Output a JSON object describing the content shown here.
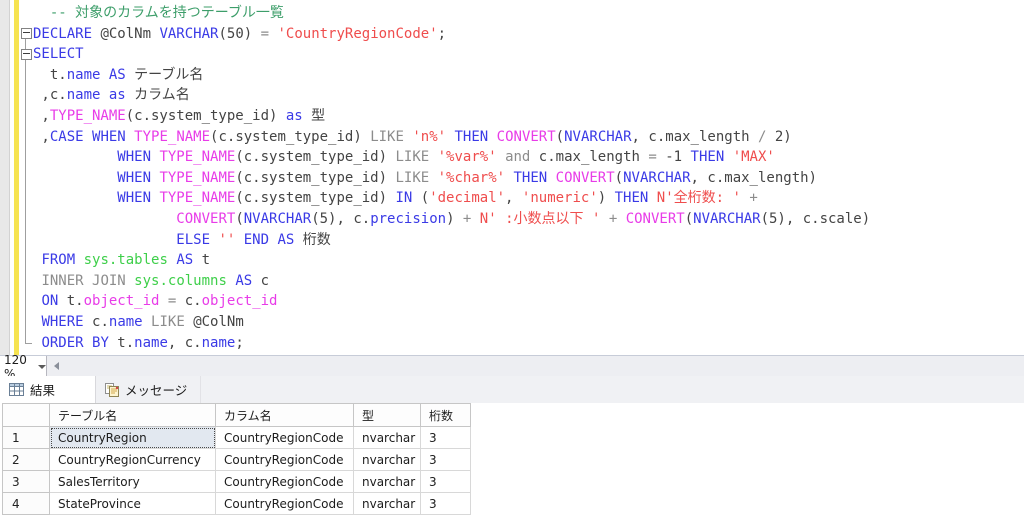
{
  "colors": {
    "keyword": "#3a3ae6",
    "operator": "#8c8c8c",
    "string": "#ef4d4d",
    "comment": "#3d9e6a",
    "system_function": "#e83ce8",
    "system_table": "#3ecf4a",
    "plain": "#444444",
    "modified_line_marker": "#f6e351"
  },
  "editor": {
    "zoom_level": "120 %",
    "code_lines": [
      {
        "tokens": [
          {
            "t": "  -- 対象のカラムを持つテーブル一覧",
            "c": "com"
          }
        ]
      },
      {
        "tokens": [
          {
            "t": "DECLARE",
            "c": "kw"
          },
          {
            "t": " @ColNm ",
            "c": "pl"
          },
          {
            "t": "VARCHAR",
            "c": "kw"
          },
          {
            "t": "(50) ",
            "c": "pl"
          },
          {
            "t": "= ",
            "c": "op"
          },
          {
            "t": "'CountryRegionCode'",
            "c": "str"
          },
          {
            "t": ";",
            "c": "pl"
          }
        ]
      },
      {
        "tokens": [
          {
            "t": "SELECT",
            "c": "kw"
          }
        ]
      },
      {
        "tokens": [
          {
            "t": "  t.",
            "c": "pl"
          },
          {
            "t": "name",
            "c": "kw"
          },
          {
            "t": " ",
            "c": "pl"
          },
          {
            "t": "AS",
            "c": "kw"
          },
          {
            "t": " テーブル名",
            "c": "pl"
          }
        ]
      },
      {
        "tokens": [
          {
            "t": " ,c.",
            "c": "pl"
          },
          {
            "t": "name",
            "c": "kw"
          },
          {
            "t": " ",
            "c": "pl"
          },
          {
            "t": "as",
            "c": "kw"
          },
          {
            "t": " カラム名",
            "c": "pl"
          }
        ]
      },
      {
        "tokens": [
          {
            "t": " ,",
            "c": "pl"
          },
          {
            "t": "TYPE_NAME",
            "c": "sys"
          },
          {
            "t": "(c.system_type_id) ",
            "c": "pl"
          },
          {
            "t": "as",
            "c": "kw"
          },
          {
            "t": " 型",
            "c": "pl"
          }
        ]
      },
      {
        "tokens": [
          {
            "t": " ,",
            "c": "pl"
          },
          {
            "t": "CASE",
            "c": "kw"
          },
          {
            "t": " ",
            "c": "pl"
          },
          {
            "t": "WHEN",
            "c": "kw"
          },
          {
            "t": " ",
            "c": "pl"
          },
          {
            "t": "TYPE_NAME",
            "c": "sys"
          },
          {
            "t": "(c.system_type_id) ",
            "c": "pl"
          },
          {
            "t": "LIKE",
            "c": "op"
          },
          {
            "t": " ",
            "c": "pl"
          },
          {
            "t": "'n%'",
            "c": "str"
          },
          {
            "t": " ",
            "c": "pl"
          },
          {
            "t": "THEN",
            "c": "kw"
          },
          {
            "t": " ",
            "c": "pl"
          },
          {
            "t": "CONVERT",
            "c": "sys"
          },
          {
            "t": "(",
            "c": "pl"
          },
          {
            "t": "NVARCHAR",
            "c": "kw"
          },
          {
            "t": ", c.max_length ",
            "c": "pl"
          },
          {
            "t": "/",
            "c": "op"
          },
          {
            "t": " 2)",
            "c": "pl"
          }
        ]
      },
      {
        "tokens": [
          {
            "t": "          ",
            "c": "pl"
          },
          {
            "t": "WHEN",
            "c": "kw"
          },
          {
            "t": " ",
            "c": "pl"
          },
          {
            "t": "TYPE_NAME",
            "c": "sys"
          },
          {
            "t": "(c.system_type_id) ",
            "c": "pl"
          },
          {
            "t": "LIKE",
            "c": "op"
          },
          {
            "t": " ",
            "c": "pl"
          },
          {
            "t": "'%var%'",
            "c": "str"
          },
          {
            "t": " ",
            "c": "pl"
          },
          {
            "t": "and",
            "c": "op"
          },
          {
            "t": " c.max_length ",
            "c": "pl"
          },
          {
            "t": "=",
            "c": "op"
          },
          {
            "t": " -1 ",
            "c": "pl"
          },
          {
            "t": "THEN",
            "c": "kw"
          },
          {
            "t": " ",
            "c": "pl"
          },
          {
            "t": "'MAX'",
            "c": "str"
          }
        ]
      },
      {
        "tokens": [
          {
            "t": "          ",
            "c": "pl"
          },
          {
            "t": "WHEN",
            "c": "kw"
          },
          {
            "t": " ",
            "c": "pl"
          },
          {
            "t": "TYPE_NAME",
            "c": "sys"
          },
          {
            "t": "(c.system_type_id) ",
            "c": "pl"
          },
          {
            "t": "LIKE",
            "c": "op"
          },
          {
            "t": " ",
            "c": "pl"
          },
          {
            "t": "'%char%'",
            "c": "str"
          },
          {
            "t": " ",
            "c": "pl"
          },
          {
            "t": "THEN",
            "c": "kw"
          },
          {
            "t": " ",
            "c": "pl"
          },
          {
            "t": "CONVERT",
            "c": "sys"
          },
          {
            "t": "(",
            "c": "pl"
          },
          {
            "t": "NVARCHAR",
            "c": "kw"
          },
          {
            "t": ", c.max_length)",
            "c": "pl"
          }
        ]
      },
      {
        "tokens": [
          {
            "t": "          ",
            "c": "pl"
          },
          {
            "t": "WHEN",
            "c": "kw"
          },
          {
            "t": " ",
            "c": "pl"
          },
          {
            "t": "TYPE_NAME",
            "c": "sys"
          },
          {
            "t": "(c.system_type_id) ",
            "c": "pl"
          },
          {
            "t": "IN",
            "c": "kw"
          },
          {
            "t": " (",
            "c": "pl"
          },
          {
            "t": "'decimal'",
            "c": "str"
          },
          {
            "t": ", ",
            "c": "pl"
          },
          {
            "t": "'numeric'",
            "c": "str"
          },
          {
            "t": ") ",
            "c": "pl"
          },
          {
            "t": "THEN",
            "c": "kw"
          },
          {
            "t": " ",
            "c": "pl"
          },
          {
            "t": "N'全桁数: '",
            "c": "str"
          },
          {
            "t": " ",
            "c": "pl"
          },
          {
            "t": "+",
            "c": "op"
          }
        ]
      },
      {
        "tokens": [
          {
            "t": "                 ",
            "c": "pl"
          },
          {
            "t": "CONVERT",
            "c": "sys"
          },
          {
            "t": "(",
            "c": "pl"
          },
          {
            "t": "NVARCHAR",
            "c": "kw"
          },
          {
            "t": "(5), c.",
            "c": "pl"
          },
          {
            "t": "precision",
            "c": "kw"
          },
          {
            "t": ") ",
            "c": "pl"
          },
          {
            "t": "+",
            "c": "op"
          },
          {
            "t": " ",
            "c": "pl"
          },
          {
            "t": "N' :小数点以下 '",
            "c": "str"
          },
          {
            "t": " ",
            "c": "pl"
          },
          {
            "t": "+",
            "c": "op"
          },
          {
            "t": " ",
            "c": "pl"
          },
          {
            "t": "CONVERT",
            "c": "sys"
          },
          {
            "t": "(",
            "c": "pl"
          },
          {
            "t": "NVARCHAR",
            "c": "kw"
          },
          {
            "t": "(5), c.scale)",
            "c": "pl"
          }
        ]
      },
      {
        "tokens": [
          {
            "t": "                 ",
            "c": "pl"
          },
          {
            "t": "ELSE",
            "c": "kw"
          },
          {
            "t": " ",
            "c": "pl"
          },
          {
            "t": "''",
            "c": "str"
          },
          {
            "t": " ",
            "c": "pl"
          },
          {
            "t": "END",
            "c": "kw"
          },
          {
            "t": " ",
            "c": "pl"
          },
          {
            "t": "AS",
            "c": "kw"
          },
          {
            "t": " 桁数",
            "c": "pl"
          }
        ]
      },
      {
        "tokens": [
          {
            "t": " ",
            "c": "pl"
          },
          {
            "t": "FROM",
            "c": "kw"
          },
          {
            "t": " ",
            "c": "pl"
          },
          {
            "t": "sys.tables",
            "c": "tbl"
          },
          {
            "t": " ",
            "c": "pl"
          },
          {
            "t": "AS",
            "c": "kw"
          },
          {
            "t": " t",
            "c": "pl"
          }
        ]
      },
      {
        "tokens": [
          {
            "t": " ",
            "c": "pl"
          },
          {
            "t": "INNER JOIN",
            "c": "op"
          },
          {
            "t": " ",
            "c": "pl"
          },
          {
            "t": "sys.columns",
            "c": "tbl"
          },
          {
            "t": " ",
            "c": "pl"
          },
          {
            "t": "AS",
            "c": "kw"
          },
          {
            "t": " c",
            "c": "pl"
          }
        ]
      },
      {
        "tokens": [
          {
            "t": " ",
            "c": "pl"
          },
          {
            "t": "ON",
            "c": "kw"
          },
          {
            "t": " t.",
            "c": "pl"
          },
          {
            "t": "object_id",
            "c": "sys"
          },
          {
            "t": " ",
            "c": "pl"
          },
          {
            "t": "=",
            "c": "op"
          },
          {
            "t": " c.",
            "c": "pl"
          },
          {
            "t": "object_id",
            "c": "sys"
          }
        ]
      },
      {
        "tokens": [
          {
            "t": " ",
            "c": "pl"
          },
          {
            "t": "WHERE",
            "c": "kw"
          },
          {
            "t": " c.",
            "c": "pl"
          },
          {
            "t": "name",
            "c": "kw"
          },
          {
            "t": " ",
            "c": "pl"
          },
          {
            "t": "LIKE",
            "c": "op"
          },
          {
            "t": " @ColNm",
            "c": "pl"
          }
        ]
      },
      {
        "tokens": [
          {
            "t": " ",
            "c": "pl"
          },
          {
            "t": "ORDER BY",
            "c": "kw"
          },
          {
            "t": " t.",
            "c": "pl"
          },
          {
            "t": "name",
            "c": "kw"
          },
          {
            "t": ", c.",
            "c": "pl"
          },
          {
            "t": "name",
            "c": "kw"
          },
          {
            "t": ";",
            "c": "pl"
          }
        ]
      }
    ]
  },
  "results": {
    "tabs": [
      {
        "label": "結果",
        "icon": "results-grid-icon",
        "active": true
      },
      {
        "label": "メッセージ",
        "icon": "messages-icon",
        "active": false
      }
    ],
    "grid": {
      "columns": [
        "テーブル名",
        "カラム名",
        "型",
        "桁数"
      ],
      "row_numbers": [
        "1",
        "2",
        "3",
        "4"
      ],
      "rows": [
        [
          "CountryRegion",
          "CountryRegionCode",
          "nvarchar",
          "3"
        ],
        [
          "CountryRegionCurrency",
          "CountryRegionCode",
          "nvarchar",
          "3"
        ],
        [
          "SalesTerritory",
          "CountryRegionCode",
          "nvarchar",
          "3"
        ],
        [
          "StateProvince",
          "CountryRegionCode",
          "nvarchar",
          "3"
        ]
      ],
      "selected_cell": {
        "row_index": 0,
        "column_index": 0,
        "value": "CountryRegion"
      }
    }
  }
}
